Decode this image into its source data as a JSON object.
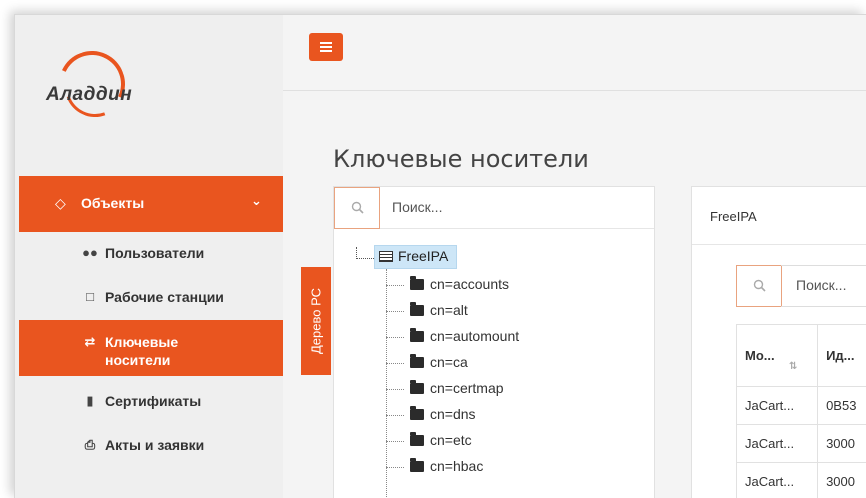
{
  "logo": {
    "text": "Аладдин"
  },
  "sidebar": {
    "header": {
      "label": "Объекты",
      "icon": "gem-icon",
      "chevron": "chevron-down-icon"
    },
    "items": [
      {
        "label": "Пользователи",
        "icon": "users-icon",
        "active": false
      },
      {
        "label": "Рабочие станции",
        "icon": "desktop-icon",
        "active": false
      },
      {
        "label": "Ключевые носители",
        "icon": "usb-icon",
        "active": true
      },
      {
        "label": "Сертификаты",
        "icon": "file-icon",
        "active": false
      },
      {
        "label": "Акты и заявки",
        "icon": "print-icon",
        "active": false
      }
    ]
  },
  "page_title": "Ключевые носители",
  "tree_tab": "Дерево РС",
  "tree": {
    "search_placeholder": "Поиск...",
    "root": "FreeIPA",
    "nodes": [
      "cn=accounts",
      "cn=alt",
      "cn=automount",
      "cn=ca",
      "cn=certmap",
      "cn=dns",
      "cn=etc",
      "cn=hbac"
    ]
  },
  "right_panel": {
    "title": "FreeIPA",
    "search_placeholder": "Поиск...",
    "columns": [
      "Мо...",
      "Ид..."
    ],
    "rows": [
      [
        "JaCart...",
        "0B53"
      ],
      [
        "JaCart...",
        "3000"
      ],
      [
        "JaCart...",
        "3000"
      ]
    ]
  },
  "colors": {
    "accent": "#e9551f",
    "selected_node": "#cde6f7"
  }
}
